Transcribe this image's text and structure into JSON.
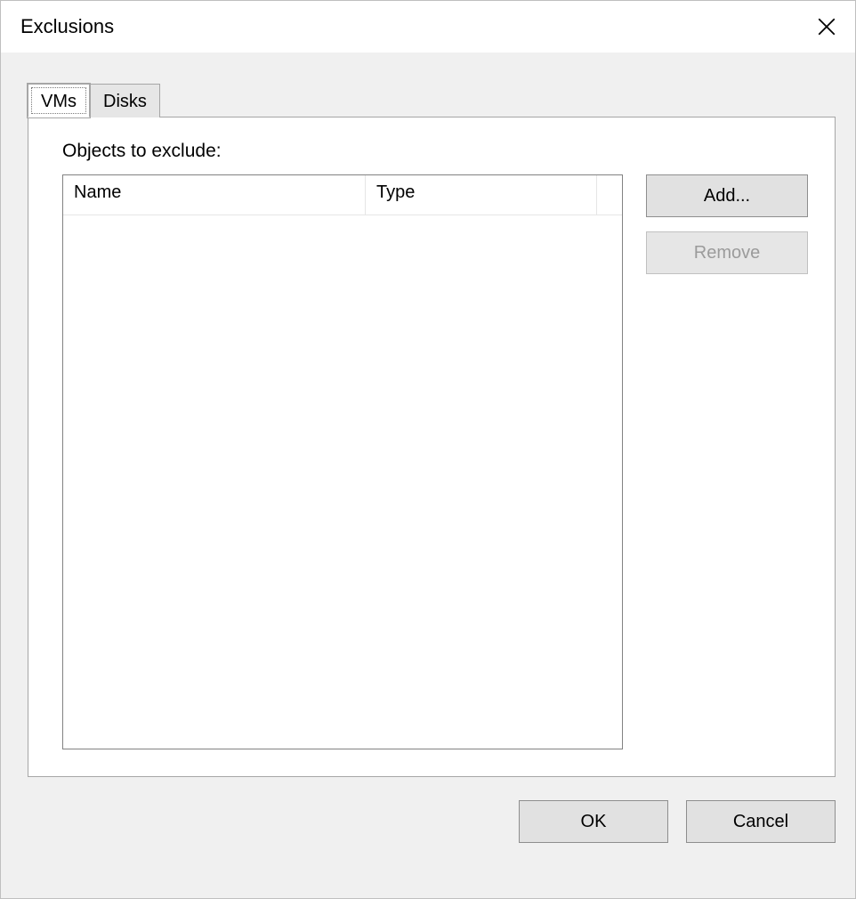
{
  "window": {
    "title": "Exclusions"
  },
  "tabs": {
    "vms": "VMs",
    "disks": "Disks",
    "active": "vms"
  },
  "section": {
    "label": "Objects to exclude:"
  },
  "listview": {
    "columns": {
      "name": "Name",
      "type": "Type"
    },
    "rows": []
  },
  "buttons": {
    "add": "Add...",
    "remove": "Remove",
    "remove_enabled": false,
    "ok": "OK",
    "cancel": "Cancel"
  }
}
